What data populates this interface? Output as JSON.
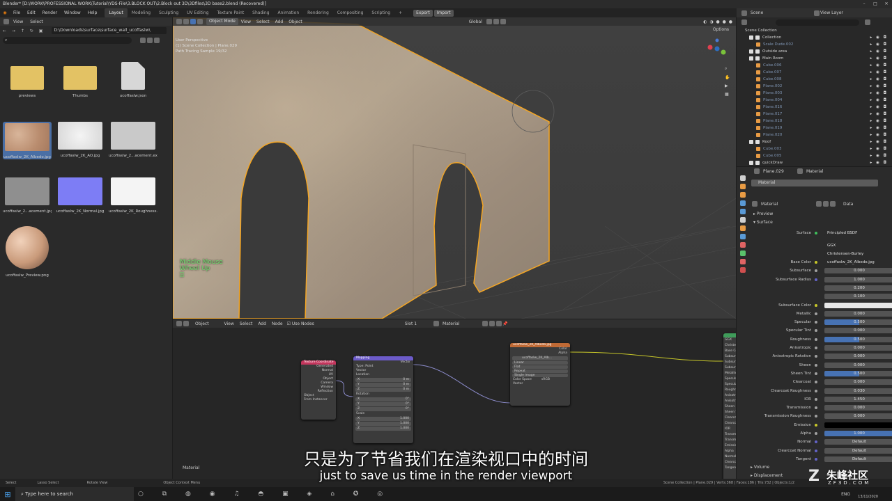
{
  "window": {
    "title": "Blender* [D:\\WORK\\PROFESSIONAL WORK\\Tutorial\\YDS-File\\3.BLOCK OUT\\2.Block out 3D\\3Dfiles\\3D base2.blend (Recovered)]"
  },
  "menus": [
    "File",
    "Edit",
    "Render",
    "Window",
    "Help"
  ],
  "workspaces": [
    "Layout",
    "Modeling",
    "Sculpting",
    "UV Editing",
    "Texture Paint",
    "Shading",
    "Animation",
    "Rendering",
    "Compositing",
    "Scripting",
    "+"
  ],
  "import_export": {
    "export": "Export",
    "import": "Import"
  },
  "scene": {
    "scene_name": "Scene",
    "view_layer": "View Layer"
  },
  "filebrowser": {
    "menu_view": "View",
    "menu_select": "Select",
    "path": "D:\\Downloads\\surface\\surface_wall_ucoffaslw\\",
    "items": [
      {
        "label": "previews",
        "kind": "folder"
      },
      {
        "label": "Thumbs",
        "kind": "folder"
      },
      {
        "label": "ucoffaslw.json",
        "kind": "file"
      },
      {
        "label": "ucoffaslw_2K_Albedo.jpg",
        "kind": "albedo"
      },
      {
        "label": "ucoffaslw_2K_AO.jpg",
        "kind": "ao"
      },
      {
        "label": "ucoffaslw_2...acement.exr",
        "kind": "disp"
      },
      {
        "label": "ucoffaslw_2...acement.jpg",
        "kind": "disp2"
      },
      {
        "label": "ucoffaslw_2K_Normal.jpg",
        "kind": "normal"
      },
      {
        "label": "ucoffaslw_2K_Roughness...",
        "kind": "rough"
      },
      {
        "label": "ucoffaslw_Preview.png",
        "kind": "sphere"
      }
    ]
  },
  "viewport": {
    "mode": "Object Mode",
    "menus": [
      "View",
      "Select",
      "Add",
      "Object"
    ],
    "transform": "Global",
    "options": "Options",
    "info_line1": "User Perspective",
    "info_line2": "(1) Scene Collection | Plane.029",
    "info_line3": "Path Tracing Sample 19/32",
    "hint_line1": "Middle Mouse",
    "hint_line2": "Wheel Up"
  },
  "node_editor": {
    "editor": "Object",
    "menus": [
      "View",
      "Select",
      "Add",
      "Node"
    ],
    "use_nodes": "Use Nodes",
    "slot": "Slot 1",
    "material": "Material",
    "footer_label": "Material",
    "texcoord": {
      "title": "Texture Coordinate",
      "outs": [
        "Generated",
        "Normal",
        "UV",
        "Object",
        "Camera",
        "Window",
        "Reflection"
      ],
      "object_label": "Object",
      "from_instancer": "From Instancer"
    },
    "mapping": {
      "title": "Mapping",
      "out": "Vector",
      "type_label": "Type",
      "type_val": "Point",
      "vector": "Vector",
      "location": "Location",
      "rotation": "Rotation",
      "scale": "Scale",
      "loc": [
        "0 m",
        "0 m",
        "0 m"
      ],
      "rot": [
        "0°",
        "0°",
        "0°"
      ],
      "scl": [
        "1.000",
        "1.000",
        "1.000"
      ],
      "axes": [
        "X",
        "Y",
        "Z"
      ]
    },
    "imagetex": {
      "title": "ucoffaslw_2K_Albedo.jpg",
      "outs": [
        "Color",
        "Alpha"
      ],
      "image": "ucoffaslw_2K_Alb...",
      "interp": "Linear",
      "proj": "Flat",
      "ext": "Repeat",
      "source": "Single Image",
      "colorspace_label": "Color Space",
      "colorspace": "sRGB",
      "vector": "Vector"
    },
    "bsdf_partial": {
      "title": "Principled BSDF",
      "labels": [
        "GGX",
        "Christensen",
        "Base Col",
        "Subsurf",
        "Subsurfa",
        "Subsurfa",
        "Metallic",
        "Specular",
        "Specular",
        "Roughnes",
        "Anisotro",
        "Anisotro",
        "Sheen",
        "Sheen Ti",
        "Clearcoa",
        "Clearcoa",
        "IOR",
        "Transmis",
        "Transmis",
        "Emission",
        "Alpha",
        "Normal",
        "Clearcoa",
        "Tangent"
      ]
    }
  },
  "outliner": {
    "root": "Scene Collection",
    "items": [
      {
        "label": "Collection",
        "depth": 0,
        "kind": "coll"
      },
      {
        "label": "Scale Dude.002",
        "depth": 1,
        "kind": "obj",
        "dim": true
      },
      {
        "label": "Outside area",
        "depth": 0,
        "kind": "coll"
      },
      {
        "label": "Main Room",
        "depth": 0,
        "kind": "coll"
      },
      {
        "label": "Cube.006",
        "depth": 1,
        "kind": "obj",
        "dim": true
      },
      {
        "label": "Cube.007",
        "depth": 1,
        "kind": "obj",
        "dim": true
      },
      {
        "label": "Cube.008",
        "depth": 1,
        "kind": "obj",
        "dim": true
      },
      {
        "label": "Plane.002",
        "depth": 1,
        "kind": "obj",
        "dim": true
      },
      {
        "label": "Plane.003",
        "depth": 1,
        "kind": "obj",
        "dim": true
      },
      {
        "label": "Plane.004",
        "depth": 1,
        "kind": "obj",
        "dim": true
      },
      {
        "label": "Plane.016",
        "depth": 1,
        "kind": "obj",
        "dim": true
      },
      {
        "label": "Plane.017",
        "depth": 1,
        "kind": "obj",
        "dim": true
      },
      {
        "label": "Plane.018",
        "depth": 1,
        "kind": "obj",
        "dim": true
      },
      {
        "label": "Plane.019",
        "depth": 1,
        "kind": "obj",
        "dim": true
      },
      {
        "label": "Plane.020",
        "depth": 1,
        "kind": "obj",
        "dim": true
      },
      {
        "label": "Roof",
        "depth": 0,
        "kind": "coll"
      },
      {
        "label": "Cube.003",
        "depth": 1,
        "kind": "obj",
        "dim": true
      },
      {
        "label": "Cube.005",
        "depth": 1,
        "kind": "obj",
        "dim": true
      },
      {
        "label": "quickDraw",
        "depth": 0,
        "kind": "coll"
      }
    ]
  },
  "properties": {
    "object": "Plane.029",
    "material_tab": "Material",
    "slot": "Material",
    "mat_name": "Material",
    "data_label": "Data",
    "preview": "Preview",
    "surface": "Surface",
    "surface_label": "Surface",
    "surface_val": "Principled BSDF",
    "dist": "GGX",
    "ss_method": "Christensen-Burley",
    "rows": [
      {
        "label": "Base Color",
        "val": "ucoffaslw_2K_Albedo.jpg",
        "dot": "#c7c729",
        "style": "link"
      },
      {
        "label": "Subsurface",
        "val": "0.000",
        "dot": "#a1a1a1",
        "style": "plain"
      },
      {
        "label": "Subsurface Radius",
        "val": "1.000",
        "dot": "#6363c7",
        "style": "plain"
      },
      {
        "label": "",
        "val": "0.200",
        "dot": "",
        "style": "plain"
      },
      {
        "label": "",
        "val": "0.100",
        "dot": "",
        "style": "plain"
      },
      {
        "label": "Subsurface Color",
        "val": "",
        "dot": "#c7c729",
        "style": "white"
      },
      {
        "label": "Metallic",
        "val": "0.000",
        "dot": "#a1a1a1",
        "style": "plain"
      },
      {
        "label": "Specular",
        "val": "0.500",
        "dot": "#a1a1a1",
        "style": "blue"
      },
      {
        "label": "Specular Tint",
        "val": "0.000",
        "dot": "#a1a1a1",
        "style": "plain"
      },
      {
        "label": "Roughness",
        "val": "0.500",
        "dot": "#a1a1a1",
        "style": "blue"
      },
      {
        "label": "Anisotropic",
        "val": "0.000",
        "dot": "#a1a1a1",
        "style": "plain"
      },
      {
        "label": "Anisotropic Rotation",
        "val": "0.000",
        "dot": "#a1a1a1",
        "style": "plain"
      },
      {
        "label": "Sheen",
        "val": "0.000",
        "dot": "#a1a1a1",
        "style": "plain"
      },
      {
        "label": "Sheen Tint",
        "val": "0.500",
        "dot": "#a1a1a1",
        "style": "blue"
      },
      {
        "label": "Clearcoat",
        "val": "0.000",
        "dot": "#a1a1a1",
        "style": "plain"
      },
      {
        "label": "Clearcoat Roughness",
        "val": "0.030",
        "dot": "#a1a1a1",
        "style": "plain"
      },
      {
        "label": "IOR",
        "val": "1.450",
        "dot": "#a1a1a1",
        "style": "plain"
      },
      {
        "label": "Transmission",
        "val": "0.000",
        "dot": "#a1a1a1",
        "style": "plain"
      },
      {
        "label": "Transmission Roughness",
        "val": "0.000",
        "dot": "#a1a1a1",
        "style": "plain"
      },
      {
        "label": "Emission",
        "val": "",
        "dot": "#c7c729",
        "style": "black"
      },
      {
        "label": "Alpha",
        "val": "1.000",
        "dot": "#a1a1a1",
        "style": "fullblue"
      },
      {
        "label": "Normal",
        "val": "Default",
        "dot": "#6363c7",
        "style": "plain"
      },
      {
        "label": "Clearcoat Normal",
        "val": "Default",
        "dot": "#6363c7",
        "style": "plain"
      },
      {
        "label": "Tangent",
        "val": "Default",
        "dot": "#6363c7",
        "style": "plain"
      }
    ],
    "volume": "Volume",
    "displacement": "Displacement"
  },
  "statusbar": {
    "select": "Select",
    "lasso": "Lasso Select",
    "rotate": "Rotate View",
    "context": "Object Context Menu",
    "stats": "Scene Collection | Plane.029 | Verts:368 | Faces:186 | Tris:732 | Objects:1/2"
  },
  "taskbar": {
    "search": "Type here to search",
    "lang": "ENG",
    "date": "13/11/2020"
  },
  "subtitle": {
    "zh": "只是为了节省我们在渲染视口中的时间",
    "en": "just to save us time in the render viewport"
  },
  "watermark": {
    "site": "朱峰社区",
    "url": "ZF3D.COM"
  },
  "colors": {
    "accent": "#4772b3",
    "selection": "#f5a623",
    "header": "#303030"
  }
}
